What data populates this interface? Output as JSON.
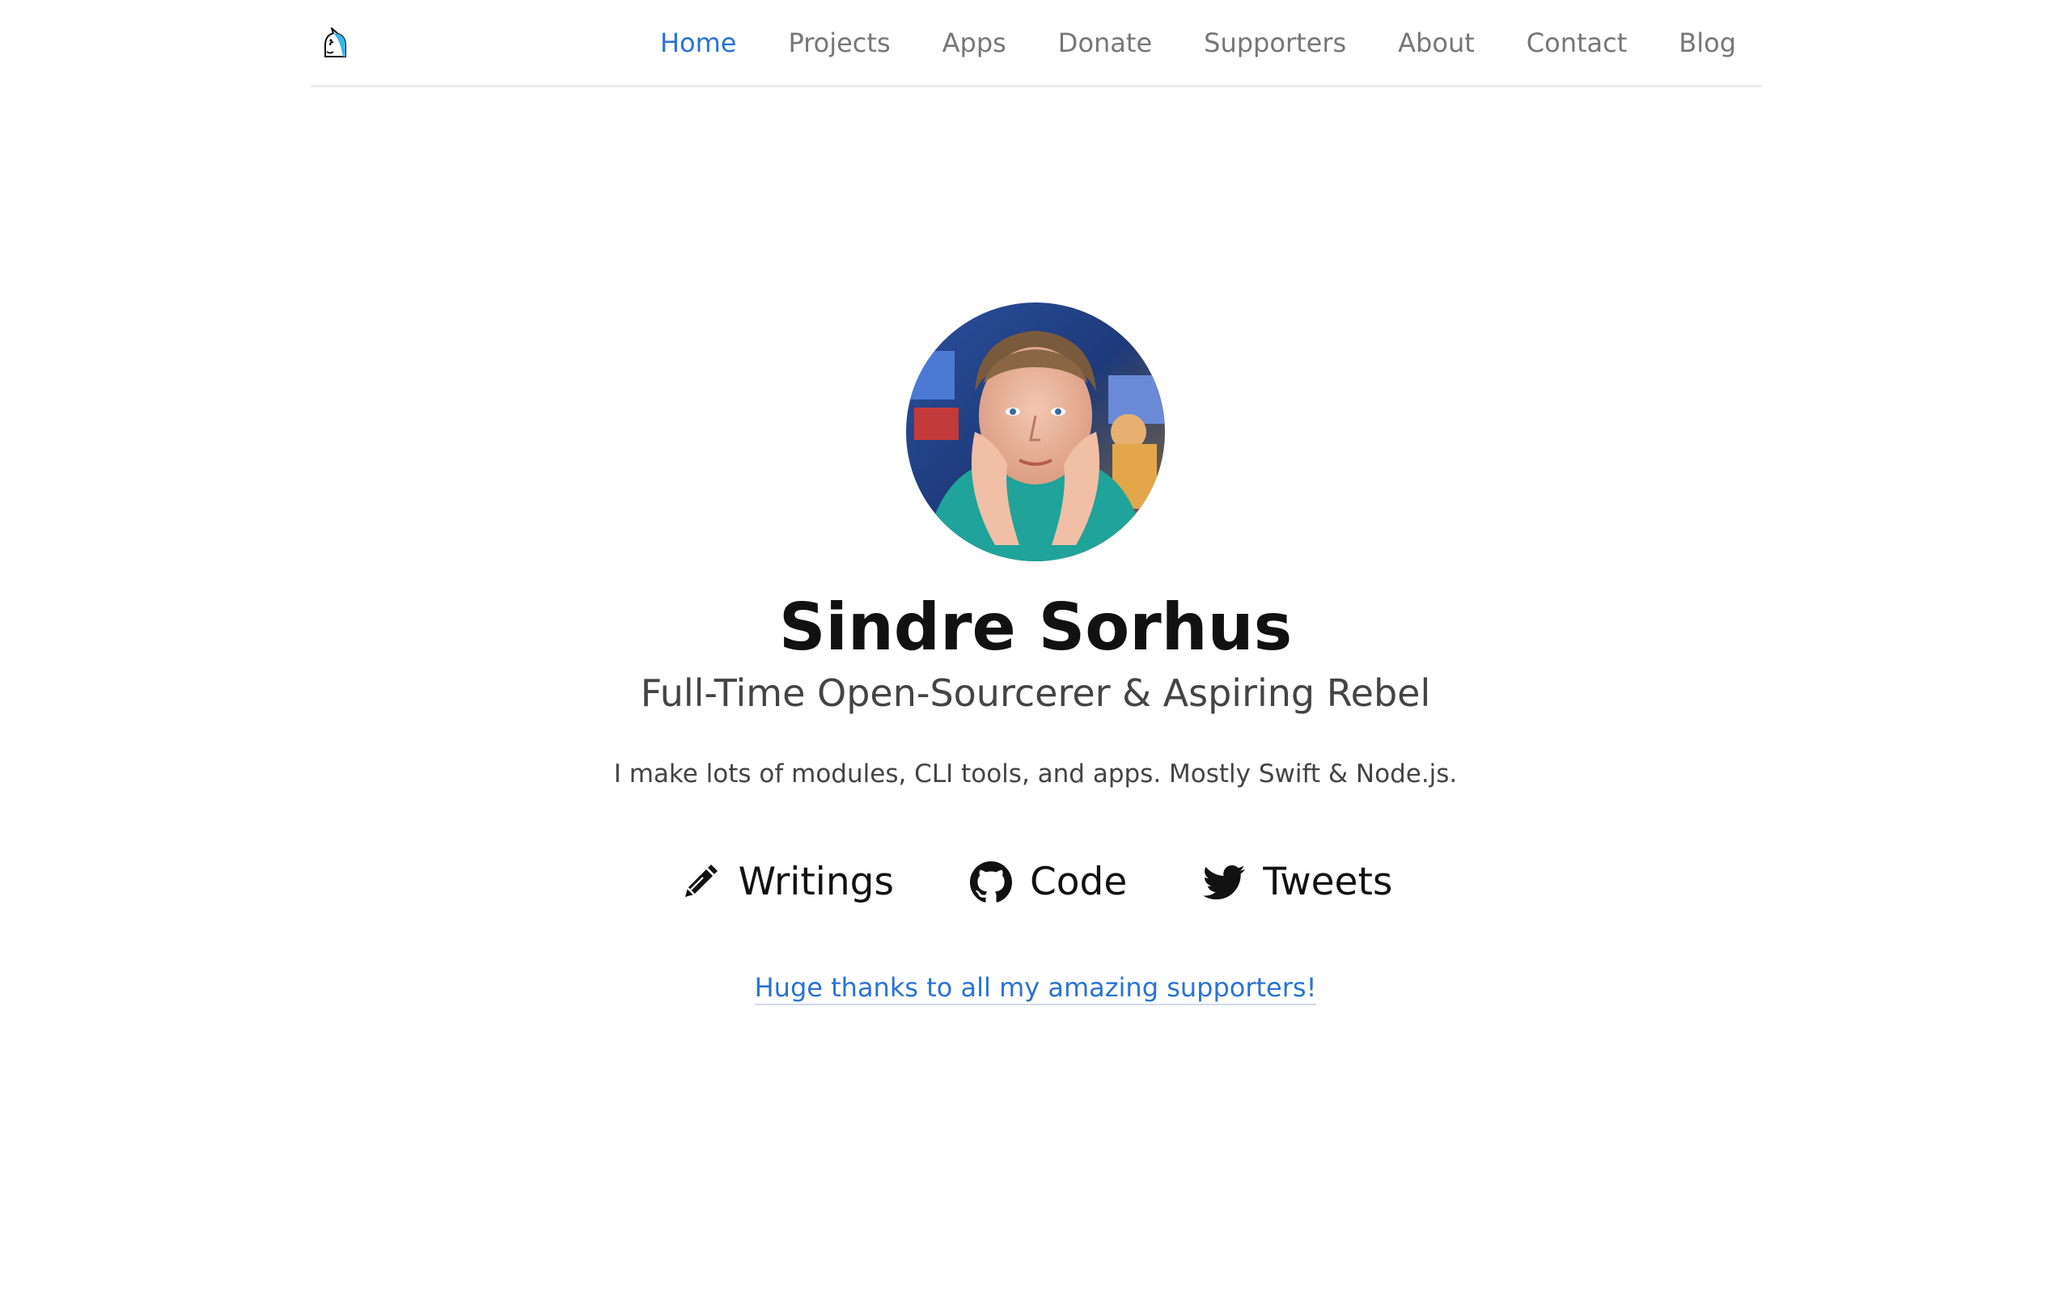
{
  "nav": {
    "logo_icon": "unicorn-icon",
    "items": [
      {
        "label": "Home",
        "active": true
      },
      {
        "label": "Projects",
        "active": false
      },
      {
        "label": "Apps",
        "active": false
      },
      {
        "label": "Donate",
        "active": false
      },
      {
        "label": "Supporters",
        "active": false
      },
      {
        "label": "About",
        "active": false
      },
      {
        "label": "Contact",
        "active": false
      },
      {
        "label": "Blog",
        "active": false
      }
    ]
  },
  "hero": {
    "name": "Sindre Sorhus",
    "tagline": "Full-Time Open-Sourcerer & Aspiring Rebel",
    "intro": "I make lots of modules, CLI tools, and apps. Mostly Swift & Node.js.",
    "links": [
      {
        "label": "Writings",
        "icon": "pencil-icon"
      },
      {
        "label": "Code",
        "icon": "github-icon"
      },
      {
        "label": "Tweets",
        "icon": "twitter-icon"
      }
    ],
    "thanks": "Huge thanks to all my amazing supporters!"
  },
  "colors": {
    "accent": "#2a73d4",
    "nav_text": "#777777",
    "heading": "#111111",
    "body_text": "#444444"
  }
}
